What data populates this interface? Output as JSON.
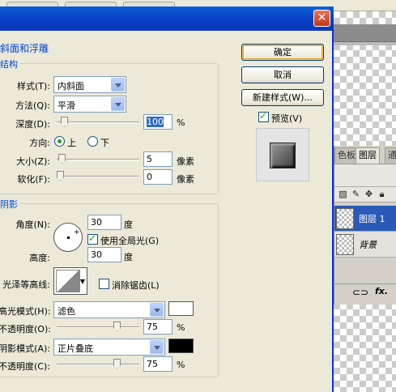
{
  "dialog": {
    "close_symbol": "✕",
    "section_title": "斜面和浮雕",
    "structure": {
      "group_label": "结构",
      "style_label": "样式(T):",
      "style_value": "内斜面",
      "technique_label": "方法(Q):",
      "technique_value": "平滑",
      "depth_label": "深度(D):",
      "depth_value": "100",
      "depth_unit": "%",
      "depth_level": 0.05,
      "direction_label": "方向:",
      "direction_up": "上",
      "direction_down": "下",
      "size_label": "大小(Z):",
      "size_value": "5",
      "size_unit": "像素",
      "size_level": 0.02,
      "soften_label": "软化(F):",
      "soften_value": "0",
      "soften_unit": "像素",
      "soften_level": 0.0
    },
    "shading": {
      "group_label": "阴影",
      "angle_label": "角度(N):",
      "angle_value": "30",
      "angle_unit": "度",
      "global_light_label": "使用全局光(G)",
      "global_light_checked": true,
      "altitude_label": "高度:",
      "altitude_value": "30",
      "altitude_unit": "度",
      "gloss_contour_label": "光泽等高线:",
      "anti_aliased_label": "消除锯齿(L)",
      "anti_aliased_checked": false,
      "highlight_mode_label": "高光模式(H):",
      "highlight_mode_value": "滤色",
      "highlight_color": "#ffffff",
      "highlight_opacity_label": "不透明度(O):",
      "highlight_opacity_value": "75",
      "highlight_opacity_unit": "%",
      "highlight_opacity_level": 0.75,
      "shadow_mode_label": "阴影模式(A):",
      "shadow_mode_value": "正片叠底",
      "shadow_color": "#000000",
      "shadow_opacity_label": "不透明度(C):",
      "shadow_opacity_value": "75",
      "shadow_opacity_unit": "%",
      "shadow_opacity_level": 0.75
    },
    "buttons": {
      "ok": "确定",
      "cancel": "取消",
      "new_style": "新建样式(W)...",
      "preview_label": "预览(V)",
      "preview_checked": true
    }
  },
  "layers_panel": {
    "tabs": [
      "色板",
      "图层",
      "通"
    ],
    "active_tab": "图层",
    "layers": [
      {
        "name": "图层 1",
        "selected": true
      },
      {
        "name": "背景",
        "selected": false
      }
    ],
    "footer_fx": "fx."
  },
  "colors": {
    "title_blue": "#0a4fd0",
    "group_label_blue": "#0046d5",
    "selected_layer": "#2a5ab8"
  }
}
